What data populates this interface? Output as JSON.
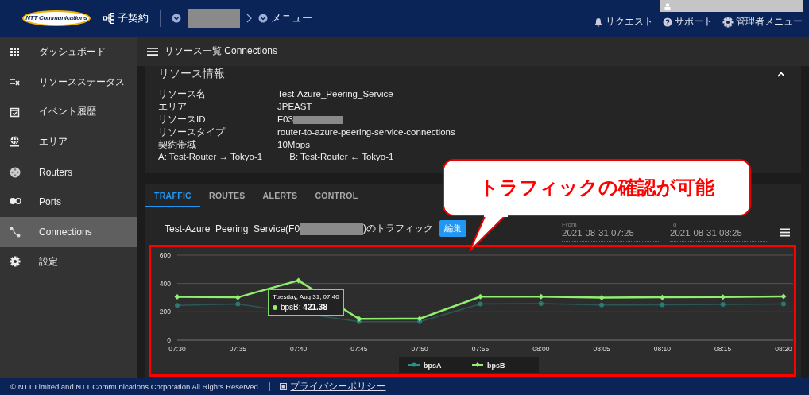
{
  "header": {
    "logo": "NTT Communications",
    "contract": "子契約",
    "menu": "メニュー",
    "links": [
      {
        "kind": "bell",
        "label": "リクエスト"
      },
      {
        "kind": "help",
        "label": "サポート"
      },
      {
        "kind": "gear",
        "label": "管理者メニュー"
      }
    ]
  },
  "sidebar": {
    "items": [
      {
        "label": "ダッシュボード",
        "selected": false
      },
      {
        "label": "リソースステータス",
        "selected": false
      },
      {
        "label": "イベント履歴",
        "selected": false
      },
      {
        "label": "エリア",
        "selected": false
      },
      {
        "label": "Routers",
        "selected": false
      },
      {
        "label": "Ports",
        "selected": false
      },
      {
        "label": "Connections",
        "selected": true
      },
      {
        "label": "設定",
        "selected": false
      }
    ]
  },
  "page_title": "リソース一覧 Connections",
  "resource_info": {
    "title": "リソース情報",
    "rows": [
      {
        "label": "リソース名",
        "value": "Test-Azure_Peering_Service"
      },
      {
        "label": "エリア",
        "value": "JPEAST"
      },
      {
        "label": "リソースID",
        "value": "F03",
        "redacted": true
      },
      {
        "label": "リソースタイプ",
        "value": "router-to-azure-peering-service-connections"
      },
      {
        "label": "契約帯域",
        "value": "10Mbps"
      }
    ],
    "endpoints": [
      "A: Test-Router → Tokyo-1",
      "B: Test-Router ← Tokyo-1"
    ]
  },
  "tabs": [
    {
      "label": "TRAFFIC",
      "selected": true
    },
    {
      "label": "ROUTES",
      "selected": false
    },
    {
      "label": "ALERTS",
      "selected": false
    },
    {
      "label": "CONTROL",
      "selected": false
    }
  ],
  "traffic": {
    "title_start": "Test-Azure_Peering_Service(F0",
    "title_end": ")のトラフィック",
    "edit_button": "編集",
    "from": {
      "label": "From",
      "value": "2021-08-31 07:25"
    },
    "to": {
      "label": "To",
      "value": "2021-08-31 08:25"
    },
    "chart_data": {
      "type": "line",
      "categories": [
        "07:30",
        "07:35",
        "07:40",
        "07:45",
        "07:50",
        "07:55",
        "08:00",
        "08:05",
        "08:10",
        "08:15",
        "08:20"
      ],
      "ylim": [
        0,
        600
      ],
      "yticks": [
        0,
        200,
        400,
        600
      ],
      "legend": "bottom",
      "series": [
        {
          "name": "bpsA",
          "color": "#2a8f8a",
          "marker": "circle",
          "values": [
            245,
            255,
            null,
            130,
            130,
            255,
            258,
            248,
            250,
            252,
            255
          ]
        },
        {
          "name": "bpsB",
          "color": "#90ee70",
          "marker": "diamond",
          "values": [
            305,
            302,
            421,
            150,
            152,
            307,
            307,
            300,
            302,
            304,
            308
          ]
        }
      ]
    },
    "tooltip": {
      "title": "Tuesday, Aug 31, 07:40",
      "text": "bpsB: **421.38**"
    }
  },
  "callout": "トラフィックの確認が可能",
  "footer": {
    "copyright": "© NTT Limited and NTT Communications Corporation All Rights Reserved.",
    "privacy": "プライバシーポリシー"
  }
}
